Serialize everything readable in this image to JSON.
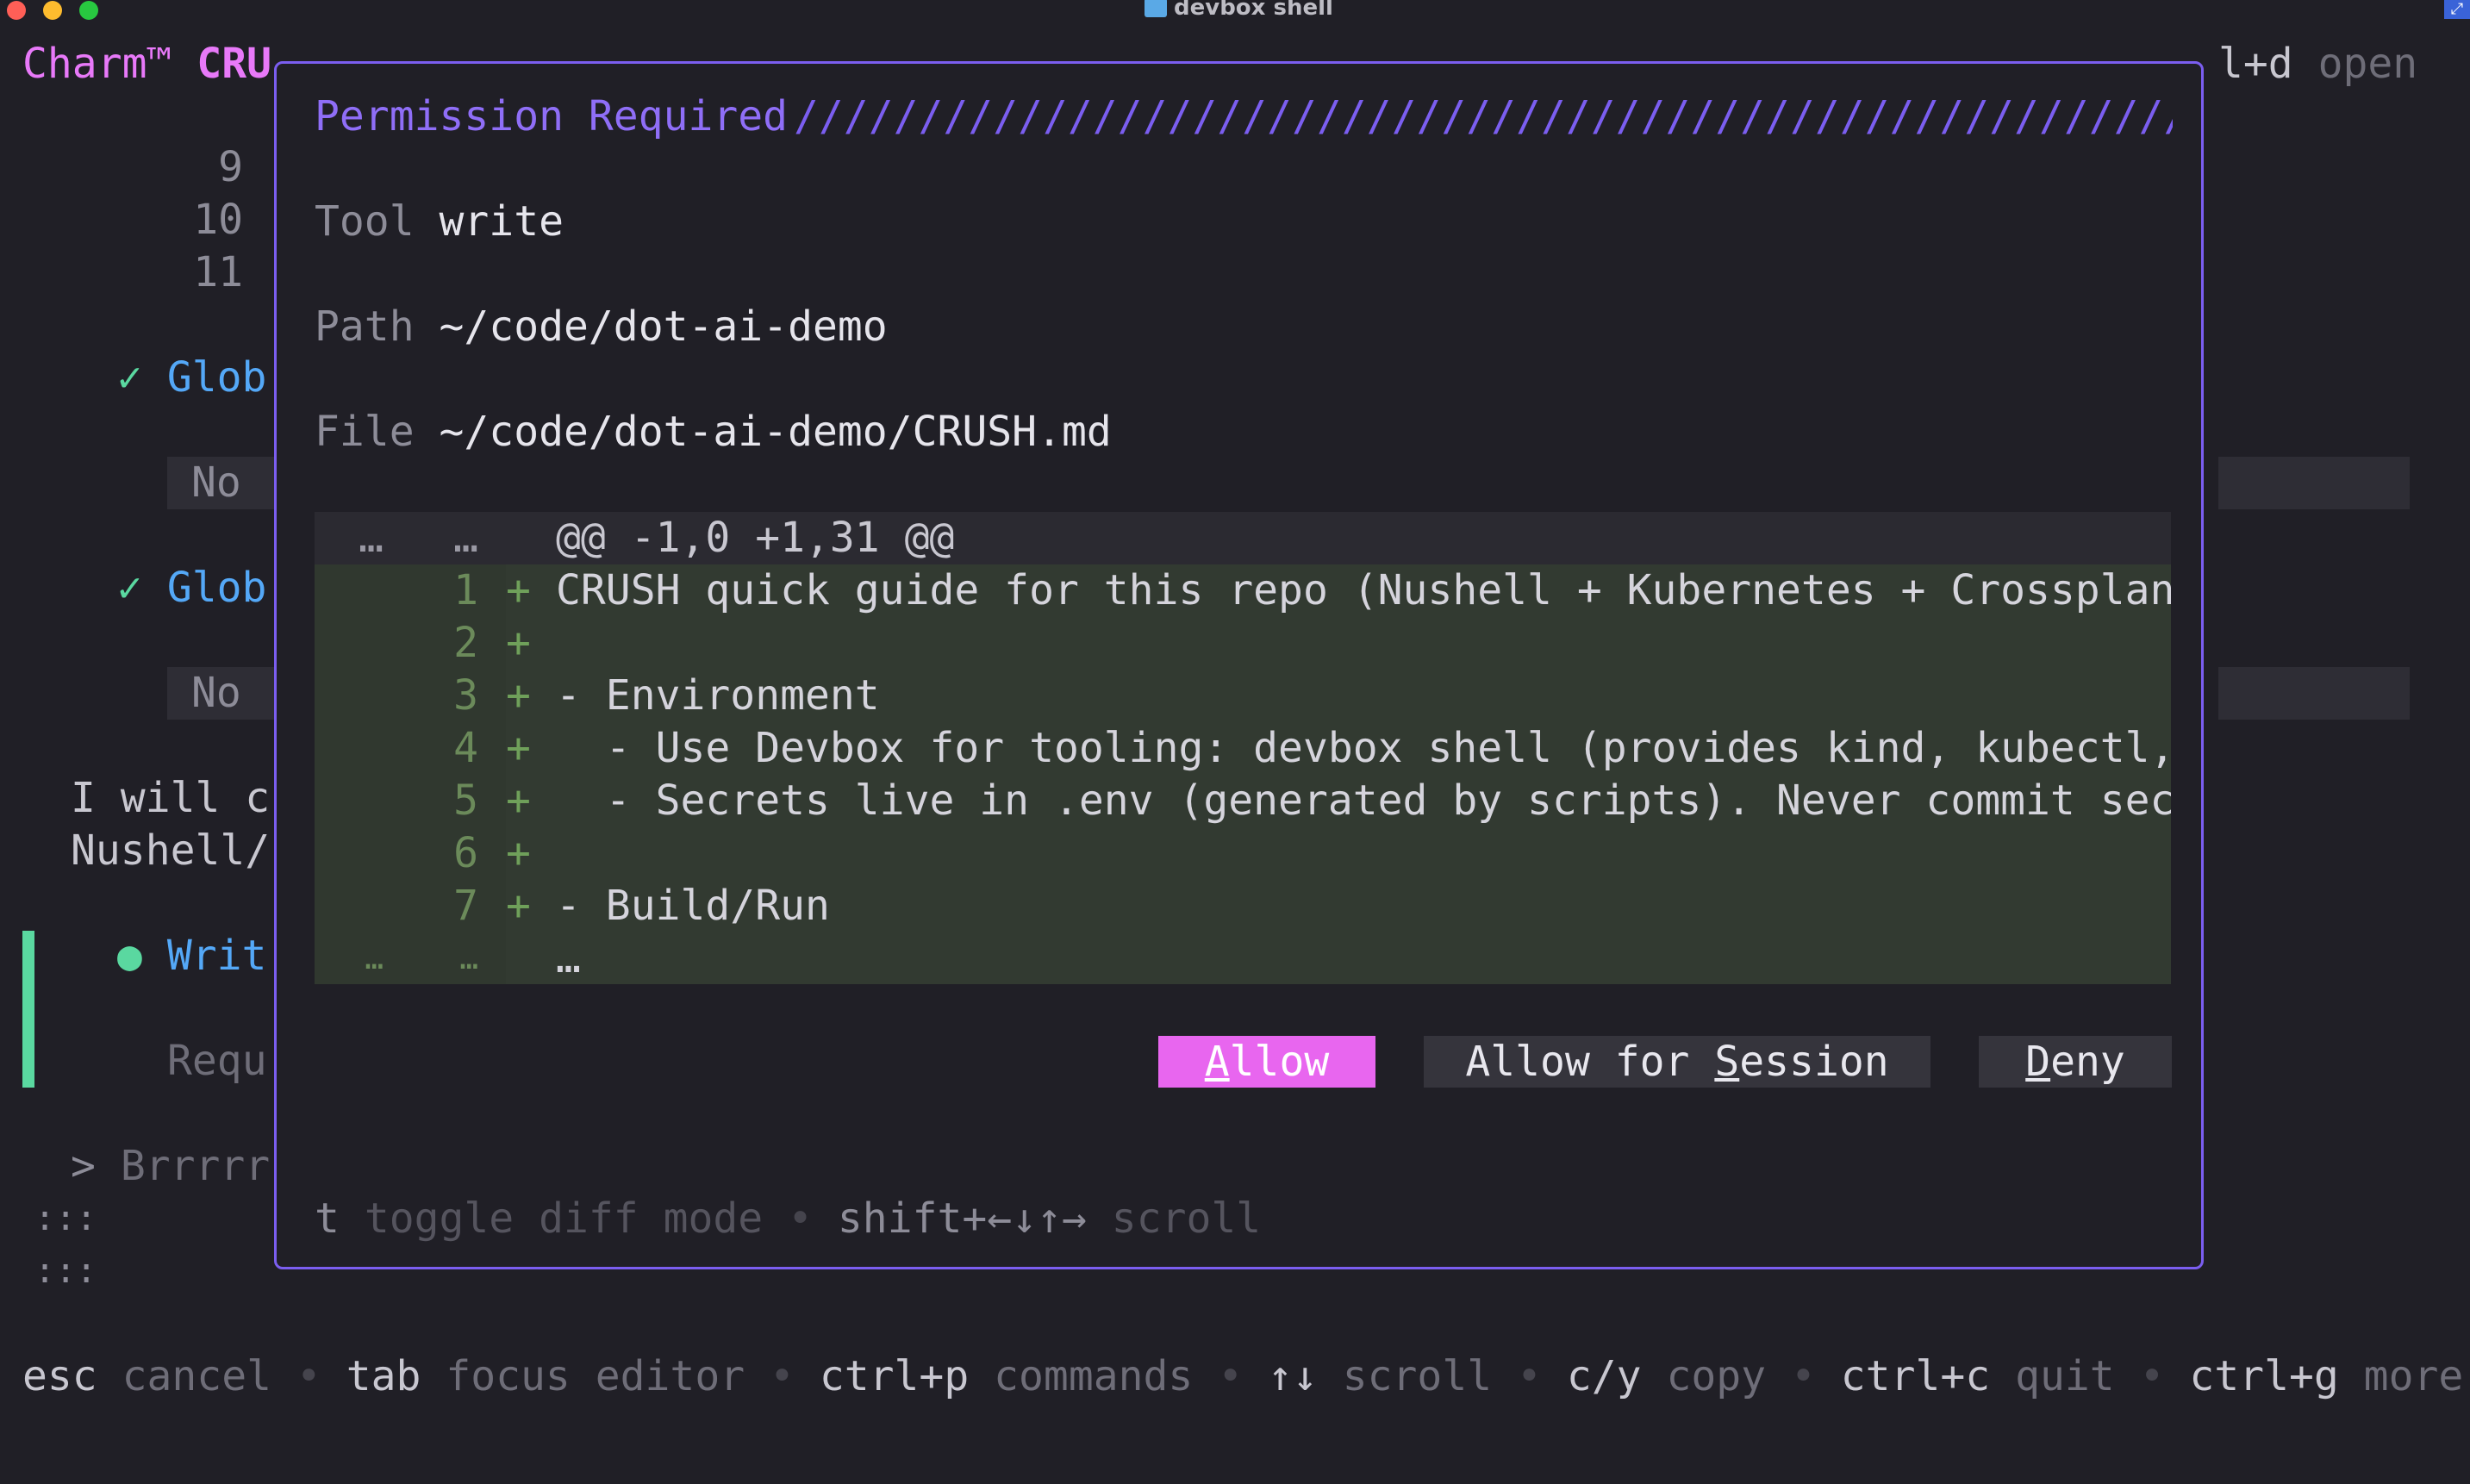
{
  "window": {
    "title": "devbox shell"
  },
  "app": {
    "brand": "Charm™",
    "name": "CRU"
  },
  "header_right": {
    "shortcut": "l+d",
    "action": "open"
  },
  "background": {
    "line_numbers": [
      "9",
      "10",
      "11"
    ],
    "tool_calls": [
      {
        "check": "✓",
        "name": "Glob",
        "result": "No"
      },
      {
        "check": "✓",
        "name": "Glob",
        "result": "No"
      }
    ],
    "message_lines": [
      "I will c",
      "Nushell/"
    ],
    "pending_tool": {
      "dot": "●",
      "name": "Writ",
      "status": "Requ"
    },
    "prompt": {
      "caret": ">",
      "text": "Brrrrr"
    },
    "spinners": [
      ":::",
      ":::"
    ]
  },
  "dialog": {
    "title": "Permission Required",
    "slashes": "////////////////////////////////////////////////////////////////////////////////////////////////////",
    "tool_label": "Tool",
    "tool_value": "write",
    "path_label": "Path",
    "path_value": "~/code/dot-ai-demo",
    "file_label": "File",
    "file_value": "~/code/dot-ai-demo/CRUSH.md",
    "diff": {
      "hunk": {
        "old": "…",
        "new": "…",
        "text": "@@ -1,0 +1,31 @@"
      },
      "lines": [
        {
          "n": "1",
          "sign": "+",
          "text": "CRUSH quick guide for this repo (Nushell + Kubernetes + Crossplane)"
        },
        {
          "n": "2",
          "sign": "+",
          "text": ""
        },
        {
          "n": "3",
          "sign": "+",
          "text": "- Environment"
        },
        {
          "n": "4",
          "sign": "+",
          "text": "  - Use Devbox for tooling: devbox shell (provides kind, kubectl, …"
        },
        {
          "n": "5",
          "sign": "+",
          "text": "  - Secrets live in .env (generated by scripts). Never commit secr…"
        },
        {
          "n": "6",
          "sign": "+",
          "text": ""
        },
        {
          "n": "7",
          "sign": "+",
          "text": "- Build/Run"
        }
      ],
      "tail": {
        "old": "…",
        "new": "…",
        "text": "…"
      }
    },
    "buttons": {
      "allow_first": "A",
      "allow_rest": "llow",
      "session_pre": "Allow for ",
      "session_key": "S",
      "session_rest": "ession",
      "deny_first": "D",
      "deny_rest": "eny"
    },
    "help": {
      "k1": "t",
      "d1": "toggle diff mode",
      "sep": "•",
      "k2": "shift+←↓↑→",
      "d2": "scroll"
    }
  },
  "footer": {
    "items": [
      {
        "key": "esc",
        "desc": "cancel"
      },
      {
        "key": "tab",
        "desc": "focus editor"
      },
      {
        "key": "ctrl+p",
        "desc": "commands"
      },
      {
        "key": "↑↓",
        "desc": "scroll"
      },
      {
        "key": "c/y",
        "desc": "copy"
      },
      {
        "key": "ctrl+c",
        "desc": "quit"
      },
      {
        "key": "ctrl+g",
        "desc": "more"
      }
    ],
    "sep": "•"
  },
  "colors": {
    "background": "#201f26",
    "accent": "#7b5ef0",
    "brand": "#e879f9",
    "allow_button": "#e866ef",
    "diff_add_bg": "#323a31",
    "success": "#5ad8a0",
    "tool_name": "#54a8f7"
  }
}
